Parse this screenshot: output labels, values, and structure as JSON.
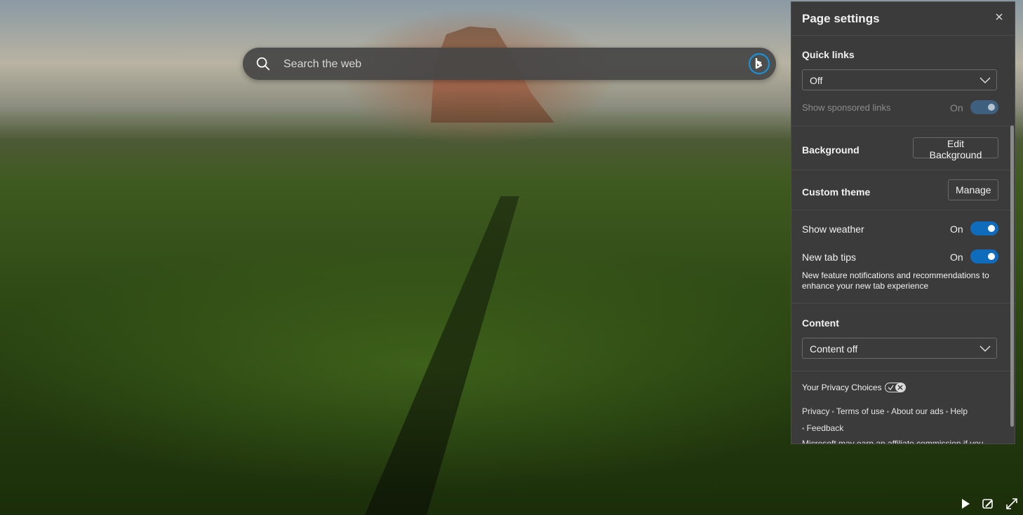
{
  "search": {
    "placeholder": "Search the web"
  },
  "panel": {
    "title": "Page settings",
    "quick_links": {
      "title": "Quick links",
      "selected": "Off",
      "sponsored_label": "Show sponsored links",
      "sponsored_state": "On"
    },
    "background": {
      "title": "Background",
      "button": "Edit Background"
    },
    "custom_theme": {
      "title": "Custom theme",
      "button": "Manage"
    },
    "weather": {
      "label": "Show weather",
      "state": "On"
    },
    "tips": {
      "label": "New tab tips",
      "state": "On",
      "description": "New feature notifications and recommendations to enhance your new tab experience"
    },
    "content": {
      "title": "Content",
      "selected": "Content off"
    },
    "footer": {
      "privacy_choices": "Your Privacy Choices",
      "links": [
        "Privacy",
        "Terms of use",
        "About our ads",
        "Help",
        "Feedback"
      ],
      "affiliate": "Microsoft may earn an affiliate commission if you"
    }
  },
  "colors": {
    "toggle_on": "#0f6cbd",
    "panel_bg": "#3b3b3b",
    "accent_bing": "#1a90d8"
  },
  "icons": [
    "search-icon",
    "bing-icon",
    "close-icon",
    "chevron-down-icon",
    "privacy-choices-icon",
    "play-icon",
    "edit-image-icon",
    "expand-icon"
  ]
}
